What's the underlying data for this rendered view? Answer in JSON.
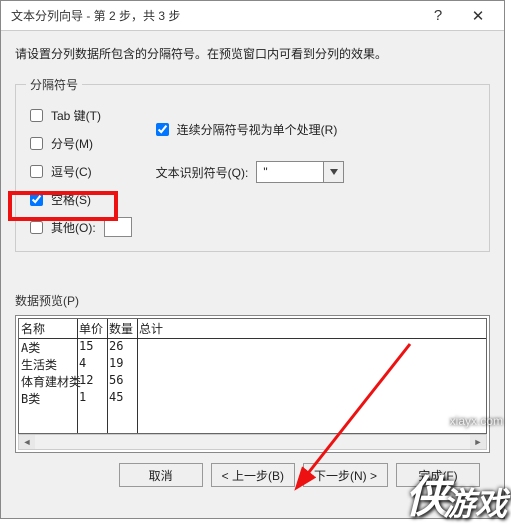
{
  "window": {
    "title": "文本分列向导 - 第 2 步，共 3 步"
  },
  "instruction": "请设置分列数据所包含的分隔符号。在预览窗口内可看到分列的效果。",
  "delimiters": {
    "legend": "分隔符号",
    "tab": {
      "label": "Tab 键(T)",
      "checked": false
    },
    "semicolon": {
      "label": "分号(M)",
      "checked": false
    },
    "comma": {
      "label": "逗号(C)",
      "checked": false
    },
    "space": {
      "label": "空格(S)",
      "checked": true
    },
    "other": {
      "label": "其他(O):",
      "checked": false,
      "value": ""
    }
  },
  "consecutive": {
    "label": "连续分隔符号视为单个处理(R)",
    "checked": true
  },
  "qualifier": {
    "label": "文本识别符号(Q):",
    "value": "\""
  },
  "preview": {
    "label": "数据预览(P)",
    "columns": [
      "名称",
      "单价",
      "数量",
      "总计"
    ],
    "rows": [
      [
        "A类",
        "15",
        "26",
        ""
      ],
      [
        "生活类",
        "4",
        "19",
        ""
      ],
      [
        "体育建材类",
        "12",
        "56",
        ""
      ],
      [
        "B类",
        "1",
        "45",
        ""
      ]
    ]
  },
  "buttons": {
    "cancel": "取消",
    "back": "< 上一步(B)",
    "next": "下一步(N) >",
    "finish": "完成(F)"
  },
  "watermark": {
    "big": "侠",
    "sub": "游戏",
    "url": "xiayx.com"
  }
}
